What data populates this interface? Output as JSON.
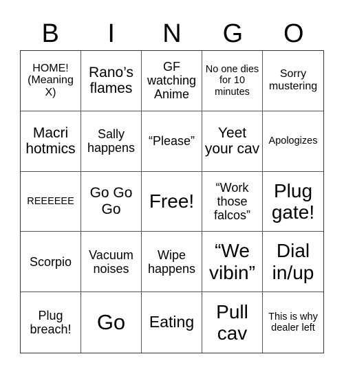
{
  "header": {
    "letters": [
      "B",
      "I",
      "N",
      "G",
      "O"
    ]
  },
  "cells": [
    {
      "text": "HOME! (Meaning X)",
      "size": "s15"
    },
    {
      "text": "Rano’s flames",
      "size": "s20"
    },
    {
      "text": "GF watching Anime",
      "size": "s17"
    },
    {
      "text": "No one dies for 10 minutes",
      "size": "s14"
    },
    {
      "text": "Sorry mustering",
      "size": "s15"
    },
    {
      "text": "Macri hotmics",
      "size": "s20"
    },
    {
      "text": "Sally happens",
      "size": "s17"
    },
    {
      "text": "“Please”",
      "size": "s17"
    },
    {
      "text": "Yeet your cav",
      "size": "s20"
    },
    {
      "text": "Apologizes",
      "size": "s14"
    },
    {
      "text": "REEEEEE",
      "size": "s14"
    },
    {
      "text": "Go Go Go",
      "size": "s20"
    },
    {
      "text": "Free!",
      "size": "s26"
    },
    {
      "text": "“Work those falcos”",
      "size": "s17"
    },
    {
      "text": "Plug gate!",
      "size": "s26"
    },
    {
      "text": "Scorpio",
      "size": "s17"
    },
    {
      "text": "Vacuum noises",
      "size": "s17"
    },
    {
      "text": "Wipe happens",
      "size": "s17"
    },
    {
      "text": "“We vibin”",
      "size": "s26"
    },
    {
      "text": "Dial in/up",
      "size": "s26"
    },
    {
      "text": "Plug breach!",
      "size": "s17"
    },
    {
      "text": "Go",
      "size": "s30"
    },
    {
      "text": "Eating",
      "size": "s22"
    },
    {
      "text": "Pull cav",
      "size": "s26"
    },
    {
      "text": "This is why dealer left",
      "size": "s14"
    }
  ]
}
